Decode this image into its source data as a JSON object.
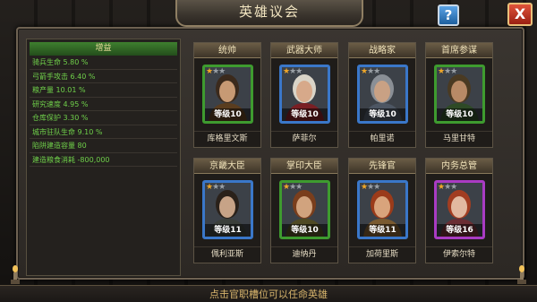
{
  "window": {
    "title": "英雄议会"
  },
  "buttons": {
    "help": "?",
    "close": "X"
  },
  "stats": {
    "header": "增益",
    "rows": [
      "骑兵生命 5.80 %",
      "弓箭手攻击 6.40 %",
      "粮产量 10.01 %",
      "研究速度 4.95 %",
      "仓库保护 3.30 %",
      "城市驻队生命 9.10 %",
      "陷阱建造容量 80",
      "建造粮食消耗 -800,000"
    ]
  },
  "officers": [
    {
      "title": "统帅",
      "name": "库格里文斯",
      "level": "等级10",
      "stars": 1,
      "border": "green",
      "skin": "#c79a74",
      "hair": "#3b2a1c",
      "cloth": "#5a3d1f"
    },
    {
      "title": "武器大师",
      "name": "萨菲尔",
      "level": "等级10",
      "stars": 1,
      "border": "blue",
      "skin": "#d7a98a",
      "hair": "#d9d4c8",
      "cloth": "#7a1f24"
    },
    {
      "title": "战略家",
      "name": "帕里诺",
      "level": "等级10",
      "stars": 1,
      "border": "blue",
      "skin": "#c9a184",
      "hair": "#8a8f96",
      "cloth": "#4d5663"
    },
    {
      "title": "首席参谋",
      "name": "马里甘特",
      "level": "等级10",
      "stars": 1,
      "border": "green",
      "skin": "#b88a66",
      "hair": "#4a3a22",
      "cloth": "#2e4a26"
    },
    {
      "title": "京畿大臣",
      "name": "佩利亚斯",
      "level": "等级11",
      "stars": 1,
      "border": "blue",
      "skin": "#c7a387",
      "hair": "#2a211a",
      "cloth": "#3b3f3a"
    },
    {
      "title": "掌印大臣",
      "name": "迪纳丹",
      "level": "等级10",
      "stars": 1,
      "border": "green",
      "skin": "#d1a37e",
      "hair": "#7a3e1c",
      "cloth": "#4f4a24"
    },
    {
      "title": "先锋官",
      "name": "加荷里斯",
      "level": "等级11",
      "stars": 1,
      "border": "blue",
      "skin": "#d9a47c",
      "hair": "#9b3b1a",
      "cloth": "#7a5a30"
    },
    {
      "title": "内务总管",
      "name": "伊索尔特",
      "level": "等级16",
      "stars": 1,
      "border": "purple",
      "skin": "#e2b9a0",
      "hair": "#a23d21",
      "cloth": "#6a2d33"
    }
  ],
  "footer": {
    "hint": "点击官职槽位可以任命英雄"
  },
  "colors": {
    "stat_text": "#6fd04a",
    "accent_gold": "#d7b46c"
  }
}
